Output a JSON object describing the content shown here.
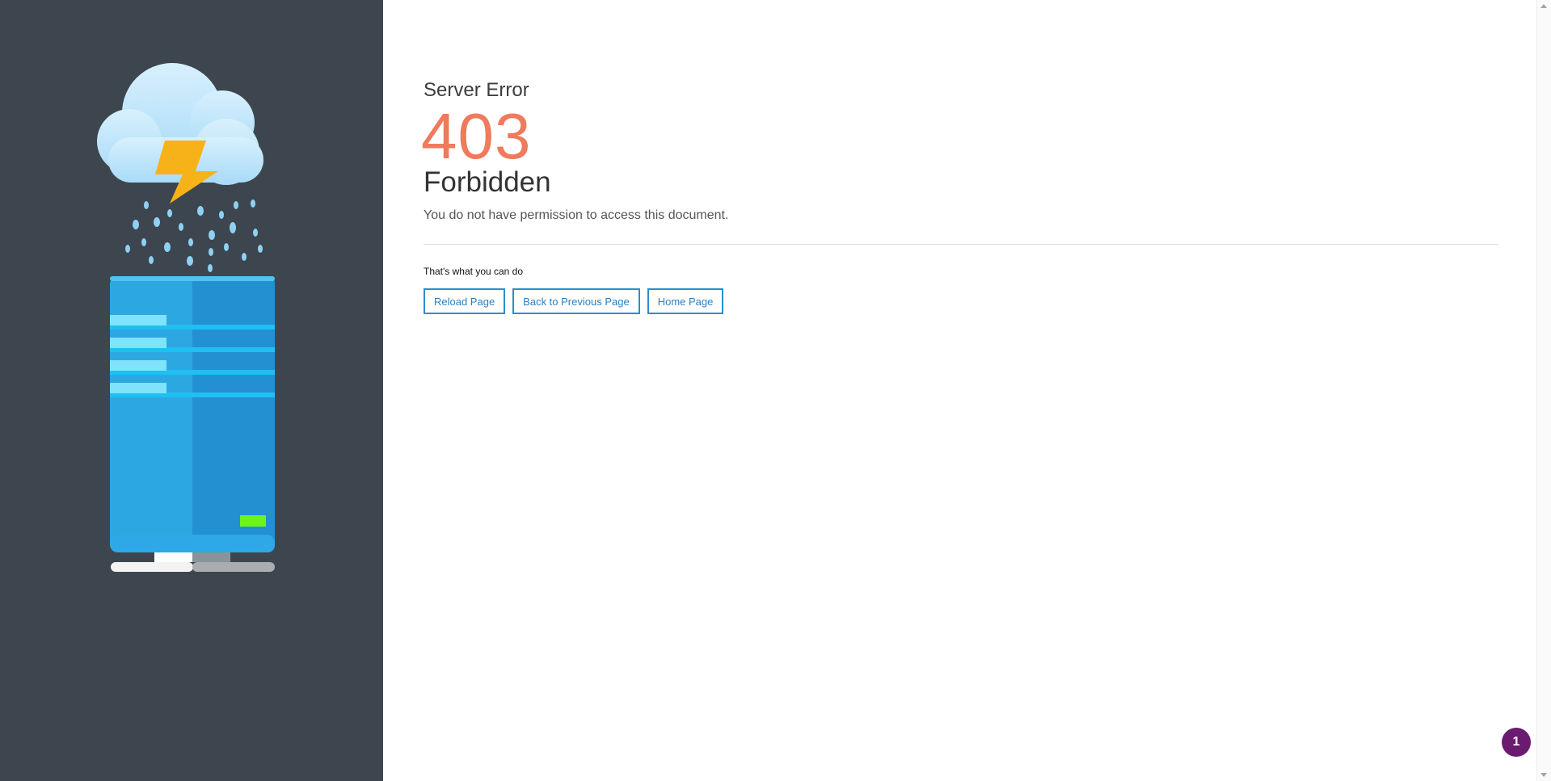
{
  "error": {
    "label": "Server Error",
    "code": "403",
    "title": "Forbidden",
    "message": "You do not have permission to access this document."
  },
  "actions": {
    "heading": "That's what you can do",
    "reload_label": "Reload Page",
    "back_label": "Back to Previous Page",
    "home_label": "Home Page"
  },
  "notification": {
    "count": "1"
  },
  "colors": {
    "sidebar": "#3d464e",
    "error_code": "#ef7a5c",
    "button_border": "#2a8fcc",
    "badge": "#6a1b6f"
  },
  "icons": {
    "illustration": "server-storm-illustration"
  }
}
